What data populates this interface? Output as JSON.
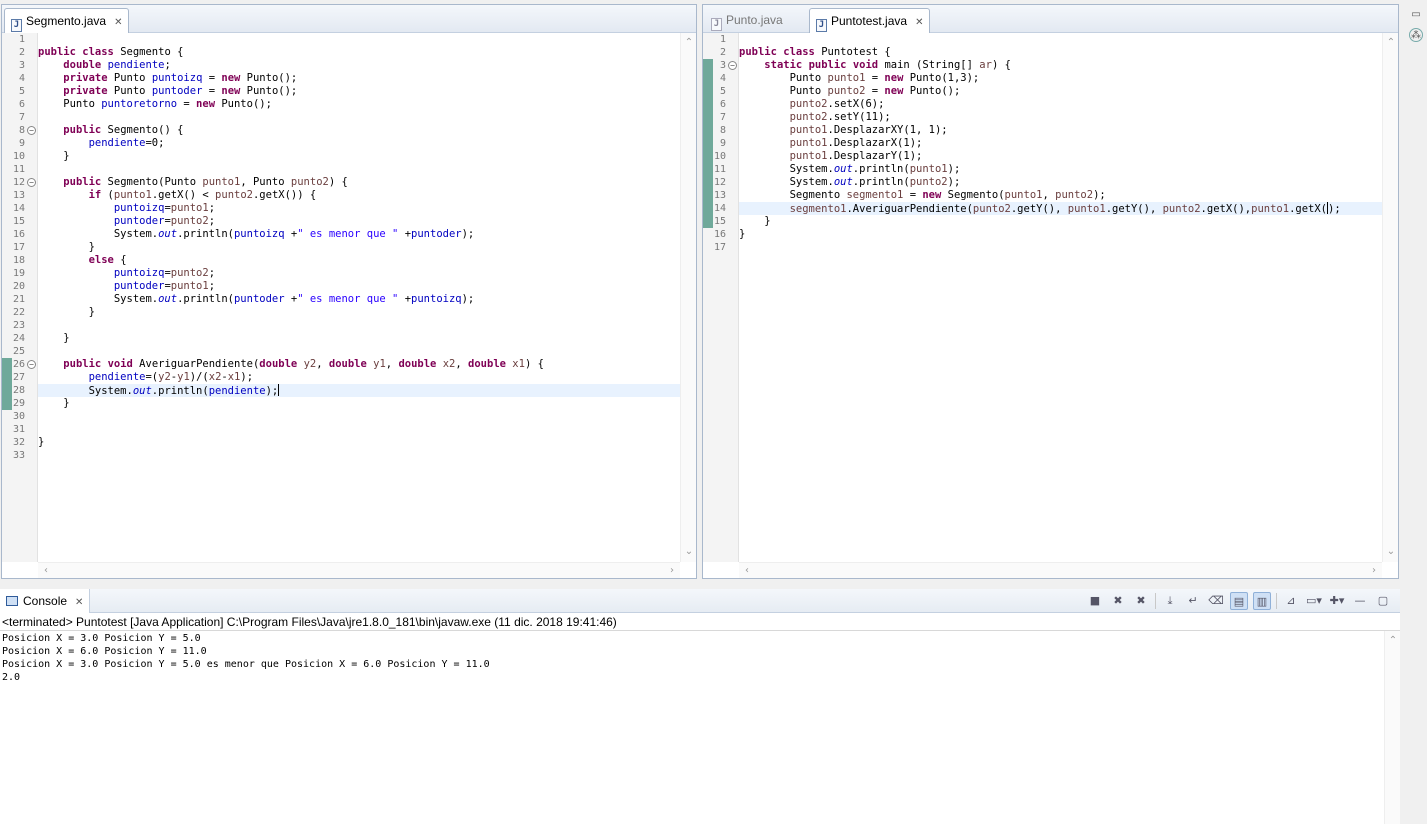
{
  "left_editor": {
    "tab": {
      "icon": "java-file-icon",
      "label": "Segmento.java"
    },
    "lines": [
      [],
      [
        {
          "t": "public",
          "c": "kw"
        },
        {
          "t": " "
        },
        {
          "t": "class",
          "c": "kw"
        },
        {
          "t": " Segmento {"
        }
      ],
      [
        {
          "t": "    "
        },
        {
          "t": "double",
          "c": "kw"
        },
        {
          "t": " "
        },
        {
          "t": "pendiente",
          "c": "fld"
        },
        {
          "t": ";"
        }
      ],
      [
        {
          "t": "    "
        },
        {
          "t": "private",
          "c": "kw"
        },
        {
          "t": " Punto "
        },
        {
          "t": "puntoizq",
          "c": "fld"
        },
        {
          "t": " = "
        },
        {
          "t": "new",
          "c": "kw"
        },
        {
          "t": " Punto();"
        }
      ],
      [
        {
          "t": "    "
        },
        {
          "t": "private",
          "c": "kw"
        },
        {
          "t": " Punto "
        },
        {
          "t": "puntoder",
          "c": "fld"
        },
        {
          "t": " = "
        },
        {
          "t": "new",
          "c": "kw"
        },
        {
          "t": " Punto();"
        }
      ],
      [
        {
          "t": "    Punto "
        },
        {
          "t": "puntoretorno",
          "c": "fld"
        },
        {
          "t": " = "
        },
        {
          "t": "new",
          "c": "kw"
        },
        {
          "t": " Punto();"
        }
      ],
      [],
      [
        {
          "t": "    "
        },
        {
          "t": "public",
          "c": "kw"
        },
        {
          "t": " Segmento() {"
        }
      ],
      [
        {
          "t": "        "
        },
        {
          "t": "pendiente",
          "c": "fld"
        },
        {
          "t": "=0;"
        }
      ],
      [
        {
          "t": "    }"
        }
      ],
      [],
      [
        {
          "t": "    "
        },
        {
          "t": "public",
          "c": "kw"
        },
        {
          "t": " Segmento(Punto "
        },
        {
          "t": "punto1",
          "c": "loc"
        },
        {
          "t": ", Punto "
        },
        {
          "t": "punto2",
          "c": "loc"
        },
        {
          "t": ") {"
        }
      ],
      [
        {
          "t": "        "
        },
        {
          "t": "if",
          "c": "kw"
        },
        {
          "t": " ("
        },
        {
          "t": "punto1",
          "c": "loc"
        },
        {
          "t": ".getX() < "
        },
        {
          "t": "punto2",
          "c": "loc"
        },
        {
          "t": ".getX()) {"
        }
      ],
      [
        {
          "t": "            "
        },
        {
          "t": "puntoizq",
          "c": "fld"
        },
        {
          "t": "="
        },
        {
          "t": "punto1",
          "c": "loc"
        },
        {
          "t": ";"
        }
      ],
      [
        {
          "t": "            "
        },
        {
          "t": "puntoder",
          "c": "fld"
        },
        {
          "t": "="
        },
        {
          "t": "punto2",
          "c": "loc"
        },
        {
          "t": ";"
        }
      ],
      [
        {
          "t": "            System."
        },
        {
          "t": "out",
          "c": "sfld"
        },
        {
          "t": ".println("
        },
        {
          "t": "puntoizq",
          "c": "fld"
        },
        {
          "t": " +"
        },
        {
          "t": "\" es menor que \"",
          "c": "str"
        },
        {
          "t": " +"
        },
        {
          "t": "puntoder",
          "c": "fld"
        },
        {
          "t": ");"
        }
      ],
      [
        {
          "t": "        }"
        }
      ],
      [
        {
          "t": "        "
        },
        {
          "t": "else",
          "c": "kw"
        },
        {
          "t": " {"
        }
      ],
      [
        {
          "t": "            "
        },
        {
          "t": "puntoizq",
          "c": "fld"
        },
        {
          "t": "="
        },
        {
          "t": "punto2",
          "c": "loc"
        },
        {
          "t": ";"
        }
      ],
      [
        {
          "t": "            "
        },
        {
          "t": "puntoder",
          "c": "fld"
        },
        {
          "t": "="
        },
        {
          "t": "punto1",
          "c": "loc"
        },
        {
          "t": ";"
        }
      ],
      [
        {
          "t": "            System."
        },
        {
          "t": "out",
          "c": "sfld"
        },
        {
          "t": ".println("
        },
        {
          "t": "puntoder",
          "c": "fld"
        },
        {
          "t": " +"
        },
        {
          "t": "\" es menor que \"",
          "c": "str"
        },
        {
          "t": " +"
        },
        {
          "t": "puntoizq",
          "c": "fld"
        },
        {
          "t": ");"
        }
      ],
      [
        {
          "t": "        }"
        }
      ],
      [],
      [
        {
          "t": "    }"
        }
      ],
      [],
      [
        {
          "t": "    "
        },
        {
          "t": "public",
          "c": "kw"
        },
        {
          "t": " "
        },
        {
          "t": "void",
          "c": "kw"
        },
        {
          "t": " AveriguarPendiente("
        },
        {
          "t": "double",
          "c": "kw"
        },
        {
          "t": " "
        },
        {
          "t": "y2",
          "c": "loc"
        },
        {
          "t": ", "
        },
        {
          "t": "double",
          "c": "kw"
        },
        {
          "t": " "
        },
        {
          "t": "y1",
          "c": "loc"
        },
        {
          "t": ", "
        },
        {
          "t": "double",
          "c": "kw"
        },
        {
          "t": " "
        },
        {
          "t": "x2",
          "c": "loc"
        },
        {
          "t": ", "
        },
        {
          "t": "double",
          "c": "kw"
        },
        {
          "t": " "
        },
        {
          "t": "x1",
          "c": "loc"
        },
        {
          "t": ") {"
        }
      ],
      [
        {
          "t": "        "
        },
        {
          "t": "pendiente",
          "c": "fld"
        },
        {
          "t": "=("
        },
        {
          "t": "y2",
          "c": "loc"
        },
        {
          "t": "-"
        },
        {
          "t": "y1",
          "c": "loc"
        },
        {
          "t": ")/("
        },
        {
          "t": "x2",
          "c": "loc"
        },
        {
          "t": "-"
        },
        {
          "t": "x1",
          "c": "loc"
        },
        {
          "t": ");"
        }
      ],
      [
        {
          "t": "        System."
        },
        {
          "t": "out",
          "c": "sfld"
        },
        {
          "t": ".println("
        },
        {
          "t": "pendiente",
          "c": "fld"
        },
        {
          "t": ");"
        },
        {
          "cursor": true
        }
      ],
      [
        {
          "t": "    }"
        }
      ],
      [],
      [],
      [
        {
          "t": "}"
        }
      ],
      []
    ],
    "fold_lines": [
      8,
      12,
      26
    ],
    "marked_lines": [
      26,
      27,
      28,
      29
    ],
    "current_line": 28
  },
  "right_editor": {
    "tabs": [
      {
        "icon": "java-file-icon",
        "label": "Punto.java",
        "active": false
      },
      {
        "icon": "java-file-icon",
        "label": "Puntotest.java",
        "active": true
      }
    ],
    "lines": [
      [],
      [
        {
          "t": "public",
          "c": "kw"
        },
        {
          "t": " "
        },
        {
          "t": "class",
          "c": "kw"
        },
        {
          "t": " Puntotest {"
        }
      ],
      [
        {
          "t": "    "
        },
        {
          "t": "static",
          "c": "kw"
        },
        {
          "t": " "
        },
        {
          "t": "public",
          "c": "kw"
        },
        {
          "t": " "
        },
        {
          "t": "void",
          "c": "kw"
        },
        {
          "t": " main (String[] "
        },
        {
          "t": "ar",
          "c": "loc"
        },
        {
          "t": ") {"
        }
      ],
      [
        {
          "t": "        Punto "
        },
        {
          "t": "punto1",
          "c": "loc"
        },
        {
          "t": " = "
        },
        {
          "t": "new",
          "c": "kw"
        },
        {
          "t": " Punto(1,3);"
        }
      ],
      [
        {
          "t": "        Punto "
        },
        {
          "t": "punto2",
          "c": "loc"
        },
        {
          "t": " = "
        },
        {
          "t": "new",
          "c": "kw"
        },
        {
          "t": " Punto();"
        }
      ],
      [
        {
          "t": "        "
        },
        {
          "t": "punto2",
          "c": "loc"
        },
        {
          "t": ".setX(6);"
        }
      ],
      [
        {
          "t": "        "
        },
        {
          "t": "punto2",
          "c": "loc"
        },
        {
          "t": ".setY(11);"
        }
      ],
      [
        {
          "t": "        "
        },
        {
          "t": "punto1",
          "c": "loc"
        },
        {
          "t": ".DesplazarXY(1, 1);"
        }
      ],
      [
        {
          "t": "        "
        },
        {
          "t": "punto1",
          "c": "loc"
        },
        {
          "t": ".DesplazarX(1);"
        }
      ],
      [
        {
          "t": "        "
        },
        {
          "t": "punto1",
          "c": "loc"
        },
        {
          "t": ".DesplazarY(1);"
        }
      ],
      [
        {
          "t": "        System."
        },
        {
          "t": "out",
          "c": "sfld"
        },
        {
          "t": ".println("
        },
        {
          "t": "punto1",
          "c": "loc"
        },
        {
          "t": ");"
        }
      ],
      [
        {
          "t": "        System."
        },
        {
          "t": "out",
          "c": "sfld"
        },
        {
          "t": ".println("
        },
        {
          "t": "punto2",
          "c": "loc"
        },
        {
          "t": ");"
        }
      ],
      [
        {
          "t": "        Segmento "
        },
        {
          "t": "segmento1",
          "c": "loc"
        },
        {
          "t": " = "
        },
        {
          "t": "new",
          "c": "kw"
        },
        {
          "t": " Segmento("
        },
        {
          "t": "punto1",
          "c": "loc"
        },
        {
          "t": ", "
        },
        {
          "t": "punto2",
          "c": "loc"
        },
        {
          "t": ");"
        }
      ],
      [
        {
          "t": "        "
        },
        {
          "t": "segmento1",
          "c": "loc"
        },
        {
          "t": ".AveriguarPendiente("
        },
        {
          "t": "punto2",
          "c": "loc"
        },
        {
          "t": ".getY(), "
        },
        {
          "t": "punto1",
          "c": "loc"
        },
        {
          "t": ".getY(), "
        },
        {
          "t": "punto2",
          "c": "loc"
        },
        {
          "t": ".getX(),"
        },
        {
          "t": "punto1",
          "c": "loc"
        },
        {
          "t": ".getX("
        },
        {
          "cursor": true
        },
        {
          "t": ");"
        }
      ],
      [
        {
          "t": "    }"
        }
      ],
      [
        {
          "t": "}"
        }
      ],
      []
    ],
    "fold_lines": [
      3
    ],
    "marked_lines": [
      3,
      4,
      5,
      6,
      7,
      8,
      9,
      10,
      11,
      12,
      13,
      14,
      15
    ],
    "current_line": 14
  },
  "console": {
    "tab_label": "Console",
    "status": "<terminated> Puntotest [Java Application] C:\\Program Files\\Java\\jre1.8.0_181\\bin\\javaw.exe (11 dic. 2018 19:41:46)",
    "output": [
      "Posicion X = 3.0 Posicion Y = 5.0",
      "Posicion X = 6.0 Posicion Y = 11.0",
      "Posicion X = 3.0 Posicion Y = 5.0 es menor que Posicion X = 6.0 Posicion Y = 11.0",
      "2.0"
    ],
    "toolbar": [
      {
        "name": "terminate-icon",
        "glyph": "■"
      },
      {
        "name": "remove-launch-icon",
        "glyph": "✖"
      },
      {
        "name": "remove-all-terminated-icon",
        "glyph": "✖"
      },
      {
        "sep": true
      },
      {
        "name": "scroll-lock-icon",
        "glyph": "⤓"
      },
      {
        "name": "word-wrap-icon",
        "glyph": "↵"
      },
      {
        "name": "clear-console-icon",
        "glyph": "⌫"
      },
      {
        "name": "show-when-stdout-icon",
        "glyph": "▤",
        "on": true
      },
      {
        "name": "show-when-stderr-icon",
        "glyph": "▥",
        "on": true
      },
      {
        "sep": true
      },
      {
        "name": "pin-console-icon",
        "glyph": "⊿"
      },
      {
        "name": "display-selected-console-icon",
        "glyph": "▭▾"
      },
      {
        "name": "open-console-icon",
        "glyph": "✚▾"
      },
      {
        "name": "minimize-icon",
        "glyph": "—"
      },
      {
        "name": "maximize-icon",
        "glyph": "▢"
      }
    ]
  }
}
